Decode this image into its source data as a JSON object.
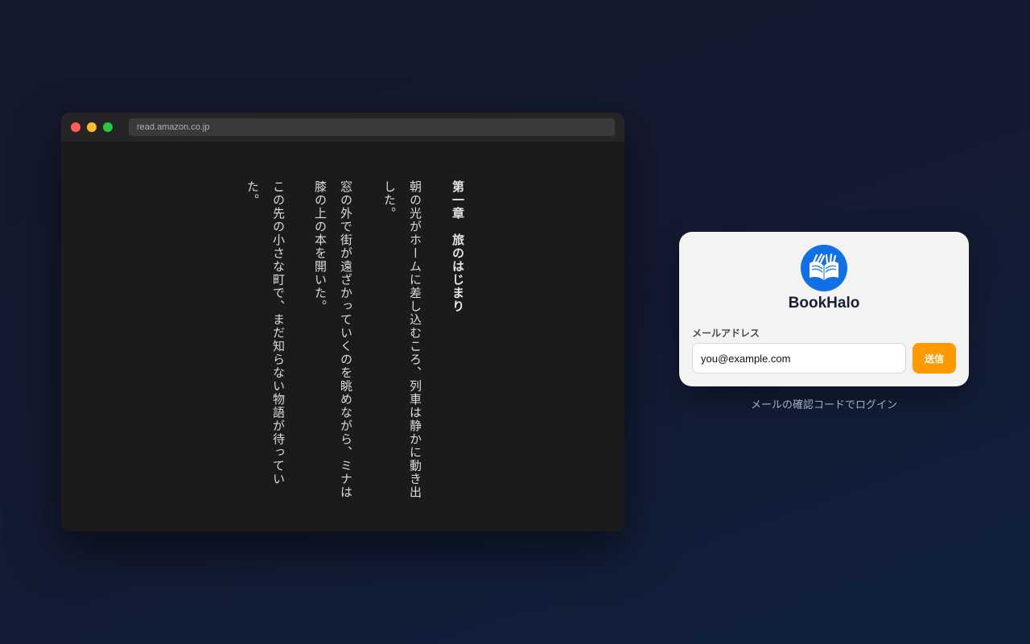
{
  "browser": {
    "url": "read.amazon.co.jp",
    "window_controls": [
      "close-dot",
      "minimize-dot",
      "maximize-dot"
    ]
  },
  "reader": {
    "paragraphs": [
      "第一章　旅のはじまり",
      "朝の光がホームに差し込むころ、列車は静かに動き出した。",
      "窓の外で街が遠ざかっていくのを眺めながら、ミナは膝の上の本を開いた。",
      "この先の小さな町で、まだ知らない物語が待っていた。"
    ]
  },
  "login": {
    "logo_icon": "open-book-icon",
    "brand_name": "BookHalo",
    "email_label": "メールアドレス",
    "email_value": "you@example.com",
    "send_label": "送信",
    "caption": "メールの確認コードでログイン"
  },
  "colors": {
    "accent": "#ff9900",
    "logo_blue": "#1170e6",
    "reader_bg": "#1b1b1b"
  }
}
